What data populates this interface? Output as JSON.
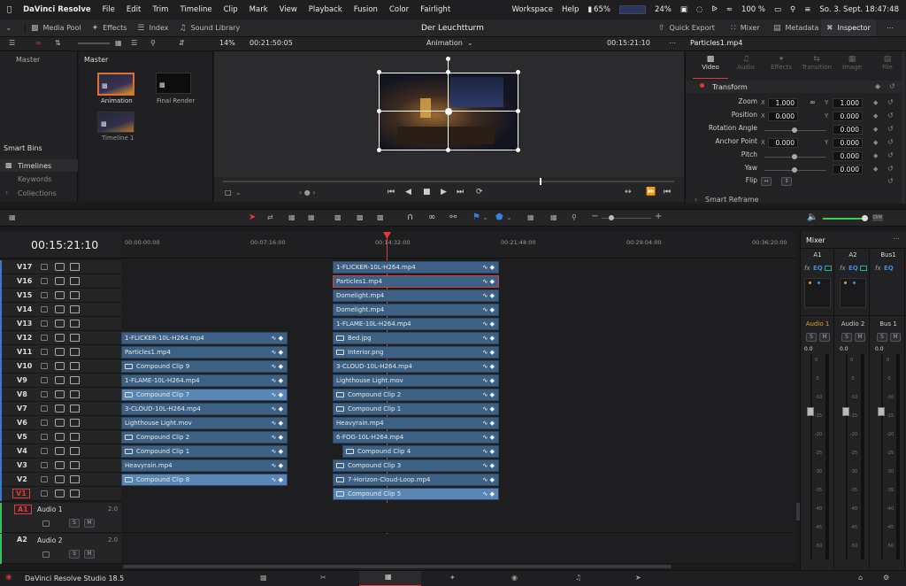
{
  "menubar": {
    "app_name": "DaVinci Resolve",
    "items": [
      "File",
      "Edit",
      "Trim",
      "Timeline",
      "Clip",
      "Mark",
      "View",
      "Playback",
      "Fusion",
      "Color",
      "Fairlight"
    ],
    "right": {
      "workspace": "Workspace",
      "help": "Help",
      "battery_left": "65%",
      "cpu": "24%",
      "battery": "100 %",
      "datetime": "So. 3. Sept.  18:47:48"
    }
  },
  "toolbar": {
    "media_pool": "Media Pool",
    "effects": "Effects",
    "index": "Index",
    "sound_library": "Sound Library",
    "project_title": "Der Leuchtturm",
    "quick_export": "Quick Export",
    "mixer": "Mixer",
    "metadata": "Metadata",
    "inspector": "Inspector"
  },
  "viewer_bar": {
    "zoom": "14%",
    "source_timecode": "00:21:50:05",
    "timeline_name": "Animation",
    "record_timecode": "00:15:21:10",
    "clip_name": "Particles1.mp4"
  },
  "media_pool": {
    "bin_master": "Master",
    "bin_header": "Master",
    "clips": [
      {
        "name": "Animation"
      },
      {
        "name": "Final Render"
      },
      {
        "name": "Timeline 1"
      }
    ],
    "smart_bins_title": "Smart Bins",
    "smart_bins": [
      "Timelines",
      "Keywords",
      "Collections"
    ]
  },
  "inspector": {
    "tabs": [
      "Video",
      "Audio",
      "Effects",
      "Transition",
      "Image",
      "File"
    ],
    "section": "Transform",
    "zoom_label": "Zoom",
    "zoom_x": "1.000",
    "zoom_y": "1.000",
    "position_label": "Position",
    "position_x": "0.000",
    "position_y": "0.000",
    "rotation_label": "Rotation Angle",
    "rotation": "0.000",
    "anchor_label": "Anchor Point",
    "anchor_x": "0.000",
    "anchor_y": "0.000",
    "pitch_label": "Pitch",
    "pitch": "0.000",
    "yaw_label": "Yaw",
    "yaw": "0.000",
    "flip_label": "Flip",
    "axis_x": "X",
    "axis_y": "Y",
    "smart_reframe": "Smart Reframe"
  },
  "timeline": {
    "timecode": "00:15:21:10",
    "ruler": [
      "00:00:00:00",
      "00:07:16:00",
      "00:14:32:00",
      "00:21:48:00",
      "00:29:04:00",
      "00:36:20:00"
    ],
    "video_tracks": [
      "V17",
      "V16",
      "V15",
      "V14",
      "V13",
      "V12",
      "V11",
      "V10",
      "V9",
      "V8",
      "V7",
      "V6",
      "V5",
      "V4",
      "V3",
      "V2",
      "V1"
    ],
    "audio_tracks": [
      {
        "id": "A1",
        "name": "Audio 1",
        "level": "2.0"
      },
      {
        "id": "A2",
        "name": "Audio 2",
        "level": "2.0"
      }
    ],
    "solo": "S",
    "mute": "M",
    "left_clips": [
      {
        "track": 5,
        "name": "1-FLICKER-10L-H264.mp4",
        "style": "dark",
        "icon": false
      },
      {
        "track": 6,
        "name": "Particles1.mp4",
        "style": "dark",
        "icon": false
      },
      {
        "track": 7,
        "name": "Compound Clip 9",
        "style": "dark",
        "icon": true
      },
      {
        "track": 8,
        "name": "1-FLAME-10L-H264.mp4",
        "style": "dark",
        "icon": false
      },
      {
        "track": 9,
        "name": "Compound Clip 7",
        "style": "light",
        "icon": true
      },
      {
        "track": 10,
        "name": "3-CLOUD-10L-H264.mp4",
        "style": "dark",
        "icon": false
      },
      {
        "track": 11,
        "name": "Lighthouse Light.mov",
        "style": "dark",
        "icon": false
      },
      {
        "track": 12,
        "name": "Compound Clip 2",
        "style": "dark",
        "icon": true
      },
      {
        "track": 13,
        "name": "Compound Clip 1",
        "style": "dark",
        "icon": true
      },
      {
        "track": 14,
        "name": "Heavyrain.mp4",
        "style": "dark",
        "icon": false
      },
      {
        "track": 15,
        "name": "Compound Clip 8",
        "style": "light",
        "icon": true
      }
    ],
    "right_clips": [
      {
        "track": 0,
        "name": "1-FLICKER-10L-H264.mp4",
        "style": "dark",
        "icon": false,
        "indent": 0
      },
      {
        "track": 1,
        "name": "Particles1.mp4",
        "style": "selected",
        "icon": false,
        "indent": 0
      },
      {
        "track": 2,
        "name": "Domelight.mp4",
        "style": "dark",
        "icon": false,
        "indent": 0
      },
      {
        "track": 3,
        "name": "Domelight.mp4",
        "style": "dark",
        "icon": false,
        "indent": 0
      },
      {
        "track": 4,
        "name": "1-FLAME-10L-H264.mp4",
        "style": "dark",
        "icon": false,
        "indent": 0
      },
      {
        "track": 5,
        "name": "Bed.jpg",
        "style": "dark",
        "icon": true,
        "indent": 0
      },
      {
        "track": 6,
        "name": "Interior.png",
        "style": "dark",
        "icon": true,
        "indent": 0
      },
      {
        "track": 7,
        "name": "3-CLOUD-10L-H264.mp4",
        "style": "dark",
        "icon": false,
        "indent": 0
      },
      {
        "track": 8,
        "name": "Lighthouse Light.mov",
        "style": "dark",
        "icon": false,
        "indent": 0
      },
      {
        "track": 9,
        "name": "Compound Clip 2",
        "style": "dark",
        "icon": true,
        "indent": 0
      },
      {
        "track": 10,
        "name": "Compound Clip 1",
        "style": "dark",
        "icon": true,
        "indent": 0
      },
      {
        "track": 11,
        "name": "Heavyrain.mp4",
        "style": "dark",
        "icon": false,
        "indent": 0
      },
      {
        "track": 12,
        "name": "6-FOG-10L-H264.mp4",
        "style": "dark",
        "icon": false,
        "indent": 0
      },
      {
        "track": 13,
        "name": "Compound Clip 4",
        "style": "dark",
        "icon": true,
        "indent": 1
      },
      {
        "track": 14,
        "name": "Compound Clip 3",
        "style": "dark",
        "icon": true,
        "indent": 0
      },
      {
        "track": 15,
        "name": "7-Horizon-Cloud-Loop.mp4",
        "style": "dark",
        "icon": true,
        "indent": 0
      },
      {
        "track": 16,
        "name": "Compound Clip 5",
        "style": "light",
        "icon": true,
        "indent": 0
      }
    ]
  },
  "mixer": {
    "title": "Mixer",
    "channels": [
      {
        "id": "A1",
        "name": "Audio 1",
        "value": "0.0"
      },
      {
        "id": "A2",
        "name": "Audio 2",
        "value": "0.0"
      },
      {
        "id": "Bus1",
        "name": "Bus 1",
        "value": "0.0"
      }
    ],
    "fx": "fx",
    "eq": "EQ",
    "scale": [
      "0",
      "-5",
      "-10",
      "-15",
      "-20",
      "-25",
      "-30",
      "-35",
      "-40",
      "-45",
      "-50"
    ]
  },
  "footer": {
    "app_label": "DaVinci Resolve Studio 18.5"
  },
  "colors": {
    "accent": "#e03a3a",
    "clip_blue": "#3d6184",
    "clip_light": "#5a86b3",
    "playhead": "#e03a3a",
    "mixer_green": "#3ad24a"
  }
}
